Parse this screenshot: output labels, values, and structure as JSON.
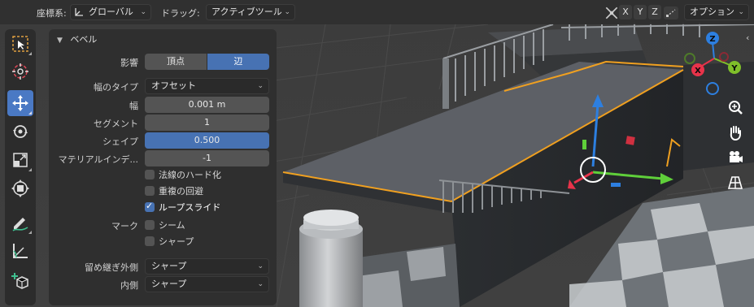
{
  "header": {
    "coord_label": "座標系:",
    "coord_value": "グローバル",
    "drag_label": "ドラッグ:",
    "drag_value": "アクティブツール",
    "axes": [
      "X",
      "Y",
      "Z"
    ],
    "options_label": "オプション"
  },
  "toolbar": {
    "tools": [
      "select-box",
      "cursor",
      "move",
      "rotate",
      "scale",
      "transform",
      "annotate",
      "measure",
      "add-cube"
    ],
    "active": "move"
  },
  "panel": {
    "title": "ベベル",
    "affect_label": "影響",
    "affect_options": [
      "頂点",
      "辺"
    ],
    "affect_selected": "辺",
    "width_type_label": "幅のタイプ",
    "width_type_value": "オフセット",
    "width_label": "幅",
    "width_value": "0.001 m",
    "segments_label": "セグメント",
    "segments_value": "1",
    "shape_label": "シェイプ",
    "shape_value": "0.500",
    "material_label": "マテリアルインデ...",
    "material_value": "-1",
    "harden_normals_label": "法線のハード化",
    "harden_normals": false,
    "clamp_overlap_label": "重複の回避",
    "clamp_overlap": false,
    "loop_slide_label": "ループスライド",
    "loop_slide": true,
    "mark_label": "マーク",
    "mark_seam_label": "シーム",
    "mark_seam": false,
    "mark_sharp_label": "シャープ",
    "mark_sharp": false,
    "miter_outer_label": "留め継ぎ外側",
    "miter_outer_value": "シャープ",
    "miter_inner_label": "内側",
    "miter_inner_value": "シャープ"
  },
  "gizmo": {
    "axis_labels": [
      "Z",
      "X",
      "Y"
    ],
    "colors": {
      "x": "#e8334a",
      "y": "#7fbf2a",
      "z": "#2d7fe0"
    }
  },
  "colors": {
    "accent": "#4772b3",
    "selection_edge": "#f0a020"
  }
}
